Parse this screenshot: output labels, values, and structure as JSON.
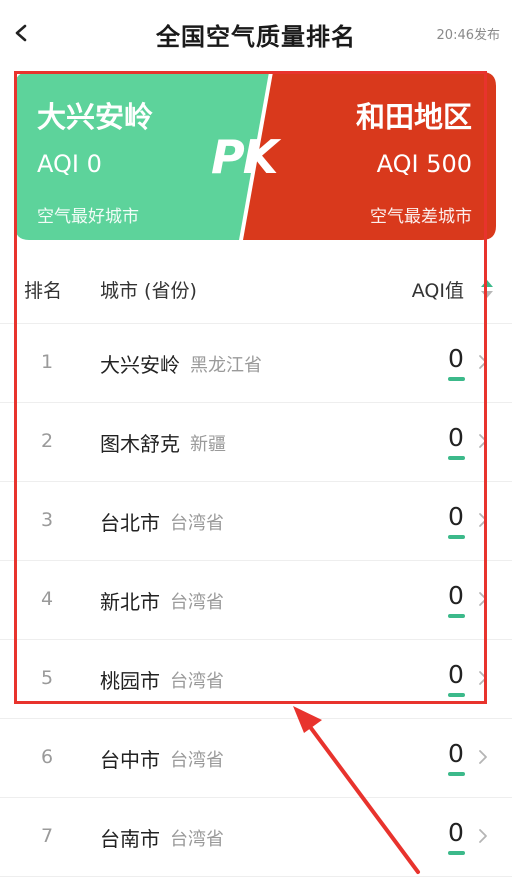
{
  "header": {
    "title": "全国空气质量排名",
    "publish_time": "20:46发布",
    "back_icon": "chevron-left-icon"
  },
  "pk": {
    "left": {
      "city": "大兴安岭",
      "aqi": "AQI 0",
      "caption": "空气最好城市",
      "color": "#5dd39b"
    },
    "mark": "PK",
    "right": {
      "city": "和田地区",
      "aqi": "AQI 500",
      "caption": "空气最差城市",
      "color": "#d9391c"
    }
  },
  "table": {
    "headers": {
      "rank": "排名",
      "city": "城市 (省份)",
      "aqi": "AQI值",
      "sort_icon": "sort-icon"
    },
    "rows": [
      {
        "rank": "1",
        "city": "大兴安岭",
        "province": "黑龙江省",
        "aqi": "0"
      },
      {
        "rank": "2",
        "city": "图木舒克",
        "province": "新疆",
        "aqi": "0"
      },
      {
        "rank": "3",
        "city": "台北市",
        "province": "台湾省",
        "aqi": "0"
      },
      {
        "rank": "4",
        "city": "新北市",
        "province": "台湾省",
        "aqi": "0"
      },
      {
        "rank": "5",
        "city": "桃园市",
        "province": "台湾省",
        "aqi": "0"
      },
      {
        "rank": "6",
        "city": "台中市",
        "province": "台湾省",
        "aqi": "0"
      },
      {
        "rank": "7",
        "city": "台南市",
        "province": "台湾省",
        "aqi": "0"
      }
    ],
    "aqi_good_color": "#3cb98a"
  },
  "annotation": {
    "color": "#e8332d"
  }
}
